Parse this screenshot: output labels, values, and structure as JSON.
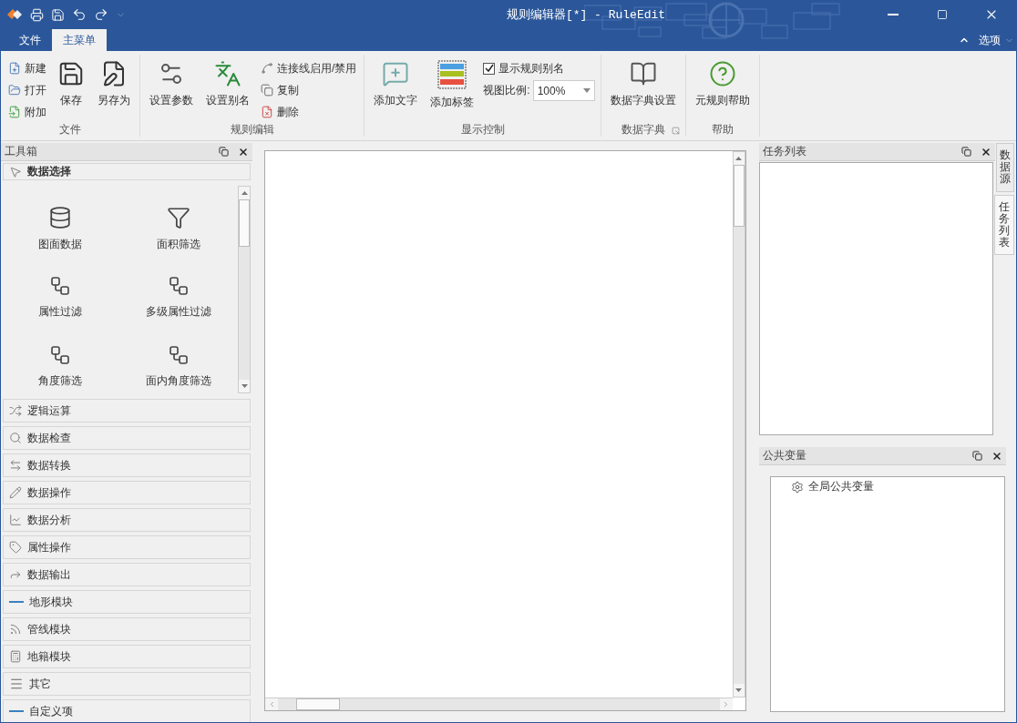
{
  "window": {
    "title": "规则编辑器[*] - RuleEdit"
  },
  "ribbon_tabs": [
    {
      "label": "文件",
      "selected": false
    },
    {
      "label": "主菜单",
      "selected": true
    }
  ],
  "options_label": "选项",
  "ribbon_groups": [
    {
      "title": "文件",
      "launcher": false,
      "columns": [
        [
          {
            "kind": "small",
            "label": "新建"
          },
          {
            "kind": "small",
            "label": "打开"
          },
          {
            "kind": "small",
            "label": "附加"
          }
        ],
        [
          {
            "kind": "large",
            "label": "保存"
          }
        ],
        [
          {
            "kind": "large",
            "label": "另存为"
          }
        ]
      ]
    },
    {
      "title": "规则编辑",
      "launcher": false,
      "columns": [
        [
          {
            "kind": "large",
            "label": "设置参数"
          }
        ],
        [
          {
            "kind": "large",
            "label": "设置别名"
          }
        ],
        [
          {
            "kind": "small",
            "label": "连接线启用/禁用"
          },
          {
            "kind": "small",
            "label": "复制"
          },
          {
            "kind": "small",
            "label": "删除"
          }
        ]
      ]
    },
    {
      "title": "显示控制",
      "launcher": false,
      "columns": [
        [
          {
            "kind": "large",
            "label": "添加文字"
          }
        ],
        [
          {
            "kind": "large",
            "label": "添加标签"
          }
        ],
        [
          {
            "kind": "check",
            "label": "显示规则别名",
            "checked": true
          },
          {
            "kind": "combo",
            "label": "视图比例:",
            "value": "100%"
          }
        ]
      ]
    },
    {
      "title": "数据字典",
      "launcher": true,
      "columns": [
        [
          {
            "kind": "large",
            "label": "数据字典设置"
          }
        ]
      ]
    },
    {
      "title": "帮助",
      "launcher": false,
      "columns": [
        [
          {
            "kind": "large",
            "label": "元规则帮助"
          }
        ]
      ]
    }
  ],
  "toolbox": {
    "title": "工具箱",
    "open_category": {
      "label": "数据选择",
      "tools": [
        {
          "label": "图面数据"
        },
        {
          "label": "面积筛选"
        },
        {
          "label": "属性过滤"
        },
        {
          "label": "多级属性过滤"
        },
        {
          "label": "角度筛选"
        },
        {
          "label": "面内角度筛选"
        }
      ]
    },
    "categories": [
      {
        "label": "逻辑运算"
      },
      {
        "label": "数据检查"
      },
      {
        "label": "数据转换"
      },
      {
        "label": "数据操作"
      },
      {
        "label": "数据分析"
      },
      {
        "label": "属性操作"
      },
      {
        "label": "数据输出"
      },
      {
        "label": "地形模块"
      },
      {
        "label": "管线模块"
      },
      {
        "label": "地籍模块"
      },
      {
        "label": "其它"
      },
      {
        "label": "自定义项"
      }
    ]
  },
  "task_panel": {
    "title": "任务列表"
  },
  "variables_panel": {
    "title": "公共变量",
    "items": [
      {
        "label": "全局公共变量"
      }
    ]
  },
  "side_tabs": [
    {
      "label": "数据源",
      "selected": false
    },
    {
      "label": "任务列表",
      "selected": true
    }
  ]
}
